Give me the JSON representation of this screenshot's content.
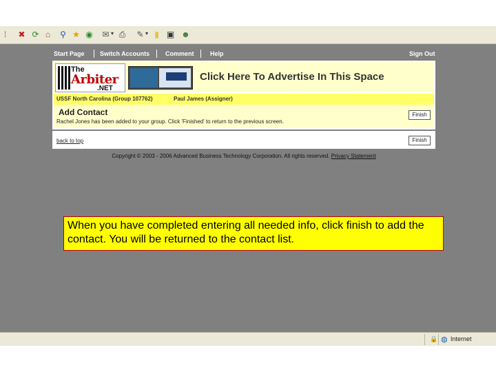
{
  "site_nav": {
    "start_page": "Start Page",
    "switch_accounts": "Switch Accounts",
    "comment": "Comment",
    "help": "Help",
    "sign_out": "Sign Out"
  },
  "logo": {
    "line1": "The",
    "line2": "Arbiter",
    "line3": ".NET"
  },
  "banner": {
    "advertise": "Click Here To Advertise In This Space"
  },
  "group": {
    "name": "USSF North Carolina (Group 107762)",
    "user": "Paul James (Assigner)"
  },
  "panel": {
    "title": "Add Contact",
    "message": "Rachel Jones has been added to your group. Click 'Finished' to return to the previous screen.",
    "finish_label": "Finish",
    "finish_label_2": "Finish",
    "back_to_top": "back to top"
  },
  "footer": {
    "copyright": "Copyright © 2003 - 2006 Advanced Business Technology Corporation. All rights reserved.",
    "privacy": "Privacy Statement"
  },
  "callout": {
    "text": "When you have completed entering all needed info, click finish to add the contact.  You will be returned to the contact list."
  },
  "status_bar": {
    "zone": "Internet"
  },
  "colors": {
    "content_bg": "#808080",
    "banner_bg": "#ffffcc",
    "group_bg": "#ffff66",
    "callout_bg": "#ffff00",
    "advertise_text": "#333333"
  },
  "toolbar_icons": [
    "separator-icon",
    "close-icon",
    "refresh-icon",
    "home-icon",
    "search-icon",
    "favorites-icon",
    "media-icon",
    "mail-icon",
    "print-icon",
    "edit-icon",
    "discuss-icon",
    "folder-icon",
    "research-icon",
    "messenger-icon"
  ]
}
